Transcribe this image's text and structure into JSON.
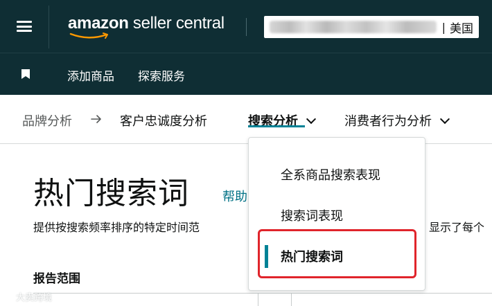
{
  "header": {
    "logo_brand": "amazon",
    "logo_product": " seller central",
    "account_separator": "|",
    "account_country": "美国",
    "colors": {
      "bar": "#0f2e34",
      "text": "#ffffff",
      "logo_smile": "#ff9900"
    }
  },
  "nav": {
    "menu_icon": "hamburger-icon",
    "bookmark_icon": "bookmark-icon",
    "links": [
      "添加商品",
      "探索服务"
    ]
  },
  "breadcrumb": {
    "items": [
      "品牌分析",
      "客户忠诚度分析",
      "搜索分析",
      "消费者行为分析"
    ],
    "separator_icon": "arrow-right-icon",
    "dropdown_icon": "chevron-down-icon",
    "active_color": "#008296"
  },
  "page": {
    "title": "热门搜索词",
    "help_link": "帮助",
    "description": "提供按搜索频率排序的特定时间范",
    "description_right": "显示了每个",
    "report_range_label": "报告范围"
  },
  "dropdown_menu": {
    "items": [
      "全系商品搜索表现",
      "搜索词表现",
      "热门搜索词"
    ],
    "selected_index": 2,
    "highlight_color": "#e0242b"
  },
  "watermark": {
    "text": "大卖跨境"
  }
}
